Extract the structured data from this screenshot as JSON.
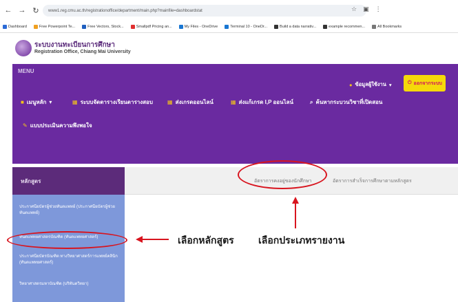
{
  "browser": {
    "url": "www1.reg.cmu.ac.th/registrationoffice/department/main.php?mainfile=dashboardstat",
    "bookmarks": [
      "Dashboard",
      "Free Powerpoint Te...",
      "Free Vectors, Stock...",
      "Smallpdf Pricing an...",
      "My Files - OneDrive",
      "Terminal 10 - OneDr...",
      "Build a data narrativ...",
      "example recommen...",
      "All Bookmarks"
    ]
  },
  "site": {
    "title": "ระบบงานทะเบียนการศึกษา",
    "subtitle": "Registration Office, Chiang Mai University"
  },
  "menu": {
    "label": "MENU",
    "items": [
      {
        "label": "เมนูหลัก",
        "icon": "folder-icon"
      },
      {
        "label": "ระบบจัดตารางเรียนตารางสอบ",
        "icon": "calendar-icon"
      },
      {
        "label": "ส่งเกรดออนไลน์",
        "icon": "calendar-icon"
      },
      {
        "label": "ส่งแก้เกรด I,P ออนไลน์",
        "icon": "calendar-icon"
      },
      {
        "label": "ค้นหากระบวนวิชาที่เปิดสอน",
        "icon": "search-icon"
      },
      {
        "label": "แบบประเมินความพึงพอใจ",
        "icon": "pencil-icon"
      }
    ],
    "user": "ข้อมูลผู้ใช้งาน",
    "logout": "ออกจากระบบ"
  },
  "sidebar": {
    "header": "หลักสูตร",
    "courses": [
      "ประกาศนียบัตรผู้ช่วยทันตแพทย์ (ประกาศนียบัตรผู้ช่วยทันตแพทย์)",
      "ทันตแพทยศาสตรบัณฑิต (ทันตแพทยศาสตร์)",
      "ประกาศนียบัตรบัณฑิต ทางวิทยาศาสตร์การแพทย์คลินิก (ทันตแพทยศาสตร์)",
      "วิทยาศาสตรมหาบัณฑิต (บริทันตวิทยา)"
    ]
  },
  "tabs": [
    "อัตราการคงอยู่ของนักศึกษา",
    "อัตราการสำเร็จการศึกษาตามหลักสูตร"
  ],
  "annotations": {
    "select_course": "เลือกหลักสูตร",
    "select_report": "เลือกประเภทรายงาน",
    "color": "#d8141e"
  }
}
